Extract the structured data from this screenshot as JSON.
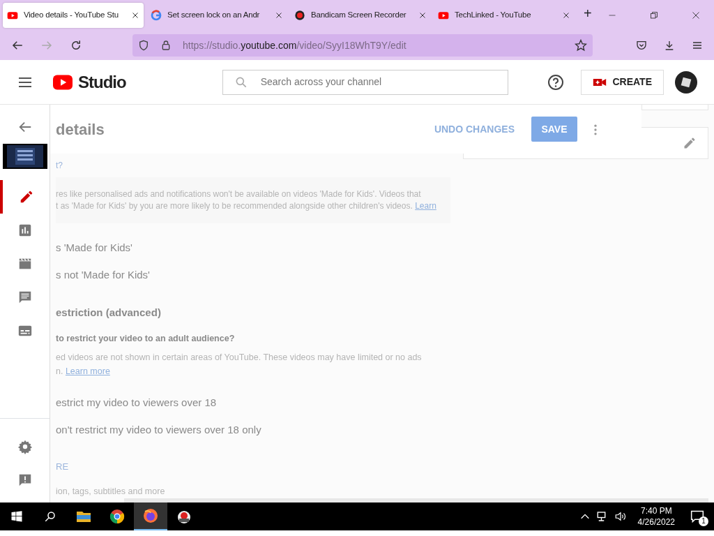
{
  "browser": {
    "tabs": [
      {
        "title": "Video details - YouTube Stu",
        "selected": true
      },
      {
        "title": "Set screen lock on an Andr",
        "selected": false
      },
      {
        "title": "Bandicam Screen Recorder",
        "selected": false
      },
      {
        "title": "TechLinked - YouTube",
        "selected": false
      }
    ],
    "new_tab": "+",
    "url": {
      "prefix": "https://studio.",
      "host": "youtube.com",
      "path": "/video/SyyI18WhT9Y/edit"
    }
  },
  "studio": {
    "logo_text": "Studio",
    "search": {
      "placeholder": "Search across your channel"
    },
    "create_label": "CREATE"
  },
  "sidebar": {
    "items": [
      {
        "selected": true
      },
      {
        "selected": false
      },
      {
        "selected": false
      },
      {
        "selected": false
      },
      {
        "selected": false
      }
    ]
  },
  "editor": {
    "title": "details",
    "undo_label": "UNDO CHANGES",
    "save_label": "SAVE",
    "content": [
      {
        "kind": "link",
        "text": "t?"
      },
      {
        "kind": "notice",
        "lines": [
          {
            "text": "res like personalised ads and notifications won't be available on videos 'Made for Kids'. Videos that"
          },
          {
            "text": "t as 'Made for Kids' by you are more likely to be recommended alongside other children's videos.",
            "link": "Learn"
          }
        ]
      },
      {
        "kind": "option",
        "text": "s 'Made for Kids'"
      },
      {
        "kind": "option",
        "text": "s not 'Made for Kids'"
      },
      {
        "kind": "heading",
        "text": "estriction (advanced)"
      },
      {
        "kind": "question",
        "text": "to restrict your video to an adult audience?"
      },
      {
        "kind": "paragraph",
        "lines": [
          {
            "text": "ed videos are not shown in certain areas of YouTube. These videos may have limited or no ads"
          },
          {
            "text": "n.",
            "link": "Learn more"
          }
        ]
      },
      {
        "kind": "option",
        "text": "estrict my video to viewers over 18"
      },
      {
        "kind": "option",
        "text": "on't restrict my video to viewers over 18 only"
      },
      {
        "kind": "more",
        "text": "RE"
      },
      {
        "kind": "caption",
        "text": "ion, tags, subtitles and more"
      }
    ]
  },
  "taskbar": {
    "apps": [
      {
        "active": false
      },
      {
        "active": false
      },
      {
        "active": true
      },
      {
        "active": false
      }
    ],
    "time": "7:40 PM",
    "date": "4/26/2022",
    "notifications": "1"
  }
}
